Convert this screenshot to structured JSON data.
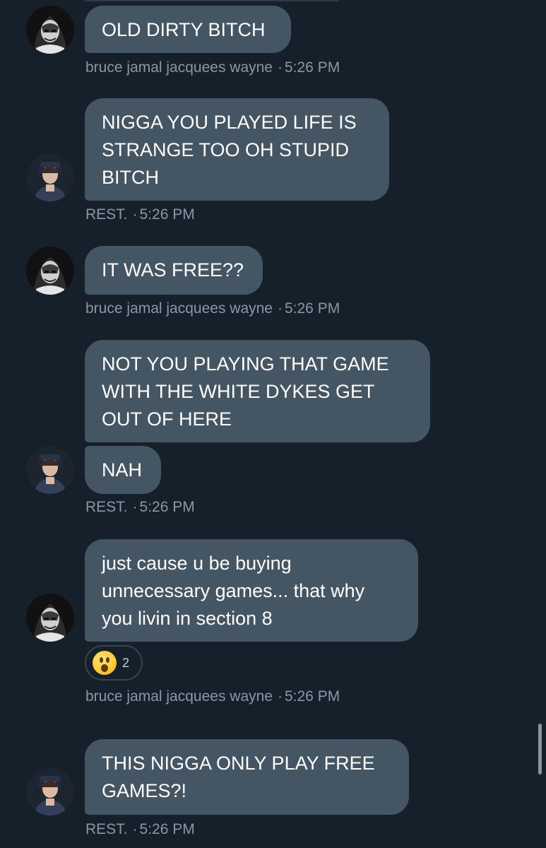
{
  "colors": {
    "background": "#15202b",
    "bubble": "#445564",
    "meta_text": "#8899a6"
  },
  "messages": [
    {
      "sender": "bruce jamal jacquees wayne",
      "avatar_icon": "hooded-figure-avatar-icon",
      "lines": [
        "OLD DIRTY BITCH"
      ]
    },
    {
      "sender": "REST.",
      "avatar_icon": "girl-portrait-avatar-icon",
      "lines": [
        "NIGGA YOU PLAYED LIFE IS",
        "STRANGE TOO OH STUPID",
        "BITCH"
      ]
    },
    {
      "sender": "bruce jamal jacquees wayne",
      "avatar_icon": "hooded-figure-avatar-icon",
      "lines": [
        "IT WAS FREE??"
      ]
    },
    {
      "sender": "REST.",
      "avatar_icon": "girl-portrait-avatar-icon",
      "lines": [
        "NOT YOU PLAYING THAT GAME",
        "WITH THE WHITE DYKES GET",
        "OUT OF HERE"
      ]
    },
    {
      "sender": "REST.",
      "avatar_icon": "girl-portrait-avatar-icon",
      "lines": [
        "NAH"
      ]
    },
    {
      "sender": "bruce jamal jacquees wayne",
      "avatar_icon": "hooded-figure-avatar-icon",
      "lines": [
        "just cause u be buying",
        "unnecessary games... that why",
        "you livin in section 8"
      ],
      "reaction": {
        "emoji": "astonished-face-icon",
        "count": "2"
      }
    },
    {
      "sender": "REST.",
      "avatar_icon": "girl-portrait-avatar-icon",
      "lines": [
        "THIS NIGGA ONLY PLAY FREE",
        "GAMES?!"
      ]
    }
  ],
  "meta_groups": [
    {
      "sender": "bruce jamal jacquees wayne",
      "time": "5:26 PM"
    },
    {
      "sender": "REST.",
      "time": "5:26 PM"
    },
    {
      "sender": "bruce jamal jacquees wayne",
      "time": "5:26 PM"
    },
    {
      "sender": "REST.",
      "time": "5:26 PM"
    },
    {
      "sender": "bruce jamal jacquees wayne",
      "time": "5:26 PM"
    },
    {
      "sender": "REST.",
      "time": "5:26 PM"
    }
  ],
  "separator": "·"
}
